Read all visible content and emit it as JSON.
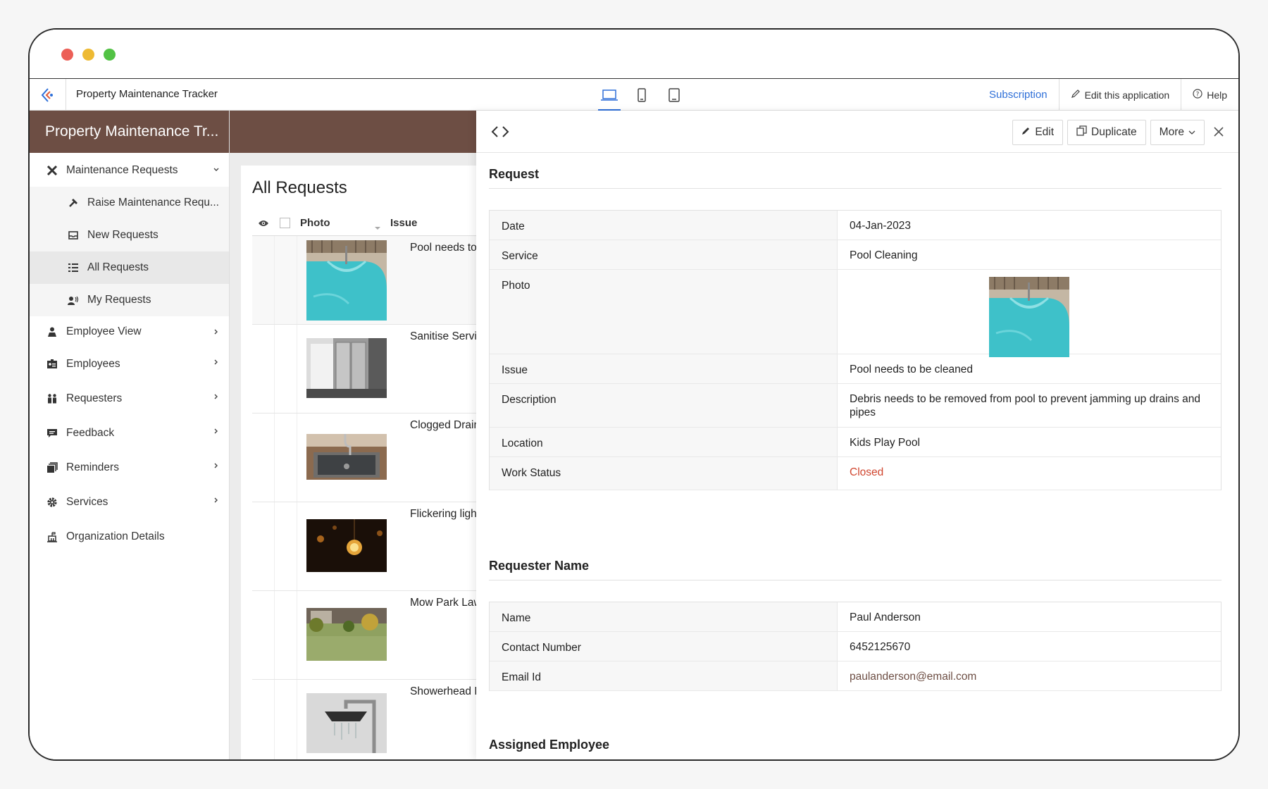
{
  "topbar": {
    "app_name": "Property Maintenance Tracker",
    "subscription": "Subscription",
    "edit_app": "Edit this application",
    "help": "Help"
  },
  "sidebar": {
    "brand": "Property Maintenance Tr...",
    "items": [
      {
        "label": "Maintenance Requests",
        "icon": "tools-icon"
      },
      {
        "label": "Raise Maintenance Requ...",
        "icon": "hammer-icon"
      },
      {
        "label": "New Requests",
        "icon": "inbox-icon"
      },
      {
        "label": "All Requests",
        "icon": "list-icon"
      },
      {
        "label": "My Requests",
        "icon": "person-speaking-icon"
      },
      {
        "label": "Employee View",
        "icon": "user-icon"
      },
      {
        "label": "Employees",
        "icon": "id-card-icon"
      },
      {
        "label": "Requesters",
        "icon": "people-icon"
      },
      {
        "label": "Feedback",
        "icon": "comment-icon"
      },
      {
        "label": "Reminders",
        "icon": "stack-icon"
      },
      {
        "label": "Services",
        "icon": "gear-icon"
      },
      {
        "label": "Organization Details",
        "icon": "building-icon"
      }
    ]
  },
  "list": {
    "title": "All Requests",
    "col_photo": "Photo",
    "col_issue": "Issue",
    "rows": [
      {
        "issue": "Pool needs to be cleaned",
        "image": "pool-photo"
      },
      {
        "issue": "Sanitise Service lift",
        "image": "elevator-photo"
      },
      {
        "issue": "Clogged Drain",
        "image": "sink-photo"
      },
      {
        "issue": "Flickering light",
        "image": "bulbs-photo"
      },
      {
        "issue": "Mow Park Lawn",
        "image": "lawn-photo"
      },
      {
        "issue": "Showerhead Blocked",
        "image": "showerhead-photo"
      }
    ]
  },
  "detail": {
    "edit": "Edit",
    "duplicate": "Duplicate",
    "more": "More",
    "request_section": "Request",
    "request_fields": [
      {
        "label": "Date",
        "value": "04-Jan-2023"
      },
      {
        "label": "Service",
        "value": "Pool Cleaning"
      },
      {
        "label": "Photo",
        "value": ""
      },
      {
        "label": "Issue",
        "value": "Pool needs to be cleaned"
      },
      {
        "label": "Description",
        "value": "Debris needs to be removed from pool to prevent jamming up drains and pipes"
      },
      {
        "label": "Location",
        "value": "Kids Play Pool"
      },
      {
        "label": "Work Status",
        "value": "Closed"
      }
    ],
    "requester_section": "Requester Name",
    "requester_fields": [
      {
        "label": "Name",
        "value": "Paul Anderson"
      },
      {
        "label": "Contact Number",
        "value": "6452125670"
      },
      {
        "label": "Email Id",
        "value": "paulanderson@email.com"
      }
    ],
    "assigned_section": "Assigned Employee"
  },
  "colors": {
    "brand": "#6d4e44",
    "accent": "#2e6fd8",
    "status_closed": "#d0462f"
  }
}
